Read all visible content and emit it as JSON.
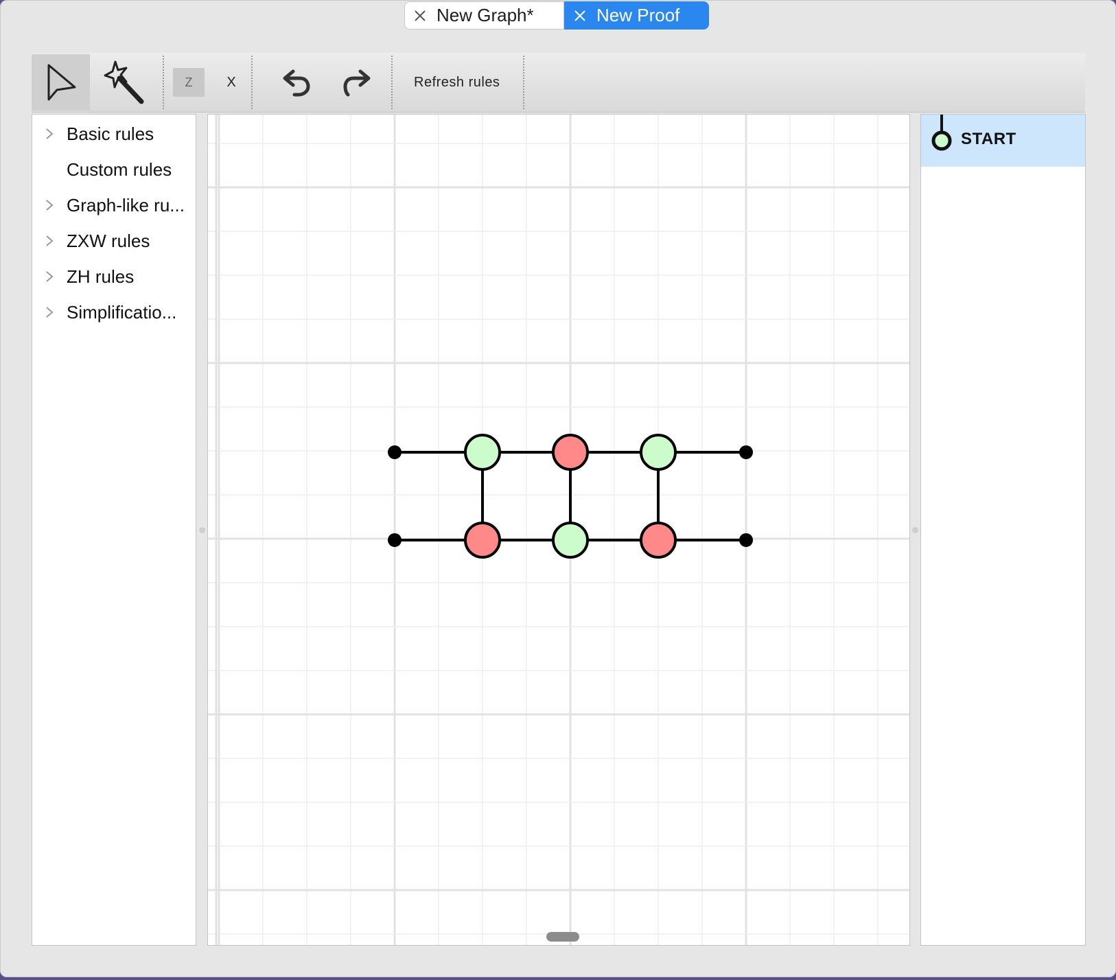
{
  "tabs": [
    {
      "label": "New Graph*",
      "active": false
    },
    {
      "label": "New Proof",
      "active": true
    }
  ],
  "toolbar": {
    "select_tool": "select-arrow-icon",
    "magic_wand_tool": "magic-wand-icon",
    "z_label": "Z",
    "x_label": "X",
    "undo": "undo-icon",
    "redo": "redo-icon",
    "refresh_label": "Refresh rules"
  },
  "rules": [
    {
      "label": "Basic rules",
      "expandable": true
    },
    {
      "label": "Custom rules",
      "expandable": false
    },
    {
      "label": "Graph-like ru...",
      "expandable": true
    },
    {
      "label": "ZXW rules",
      "expandable": true
    },
    {
      "label": "ZH rules",
      "expandable": true
    },
    {
      "label": "Simplificatio...",
      "expandable": true
    }
  ],
  "graph": {
    "colors": {
      "z_spider": "#ccfbcc",
      "x_spider": "#ff8888",
      "boundary": "#000000",
      "edge": "#000000"
    },
    "top_row": [
      "boundary",
      "Z",
      "X",
      "Z",
      "boundary"
    ],
    "bottom_row": [
      "boundary",
      "X",
      "Z",
      "X",
      "boundary"
    ],
    "vertical_edges_at_columns": [
      1,
      2,
      3
    ]
  },
  "proof_steps": [
    {
      "label": "START",
      "selected": true
    }
  ]
}
